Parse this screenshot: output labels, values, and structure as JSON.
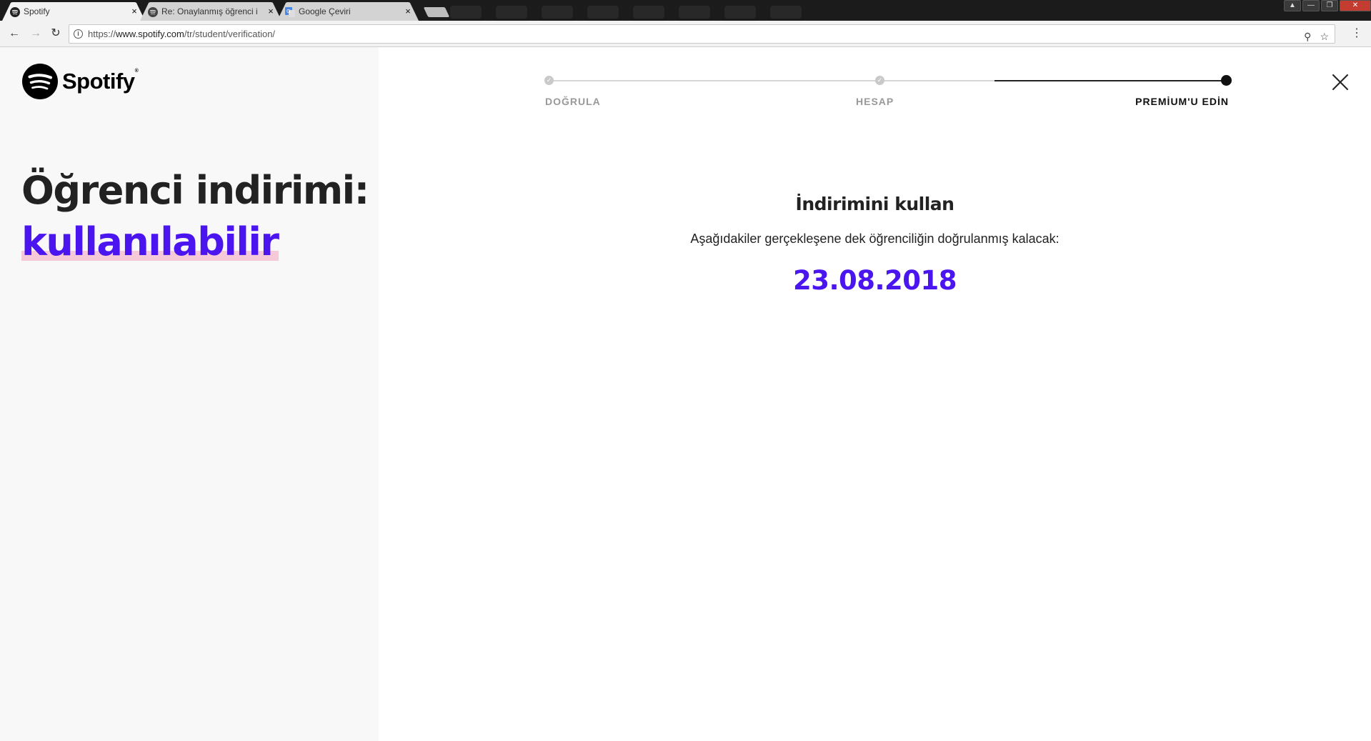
{
  "browser": {
    "tabs": [
      {
        "title": "Spotify",
        "close": "×"
      },
      {
        "title": "Re: Onaylanmış öğrenci i",
        "close": "×"
      },
      {
        "title": "Google Çeviri",
        "close": "×"
      }
    ],
    "url_prefix": "https://",
    "url_host": "www.spotify.com",
    "url_path": "/tr/student/verification/",
    "nav_back": "←",
    "nav_forward": "→",
    "nav_reload": "↻",
    "info_glyph": "i",
    "zoom_glyph": "⚲",
    "star_glyph": "☆",
    "menu_glyph": "⋮",
    "window_controls": [
      "▲",
      "—",
      "❐",
      "✕"
    ]
  },
  "brand": {
    "name": "Spotify",
    "reg_mark": "®",
    "color": "#000000"
  },
  "headline": {
    "line1": "Öğrenci indirimi:",
    "line2": "kullanılabilir",
    "accent_color": "#4a15ef",
    "highlight_color": "#f6c9d8"
  },
  "stepper": {
    "steps": [
      {
        "label": "DOĞRULA",
        "state": "done",
        "glyph": "✓"
      },
      {
        "label": "HESAP",
        "state": "done",
        "glyph": "✓"
      },
      {
        "label": "PREMİUM'U EDİN",
        "state": "current",
        "glyph": ""
      }
    ]
  },
  "main": {
    "title": "İndirimini kullan",
    "description": "Aşağıdakiler gerçekleşene dek öğrenciliğin doğrulanmış kalacak:",
    "date": "23.08.2018"
  }
}
